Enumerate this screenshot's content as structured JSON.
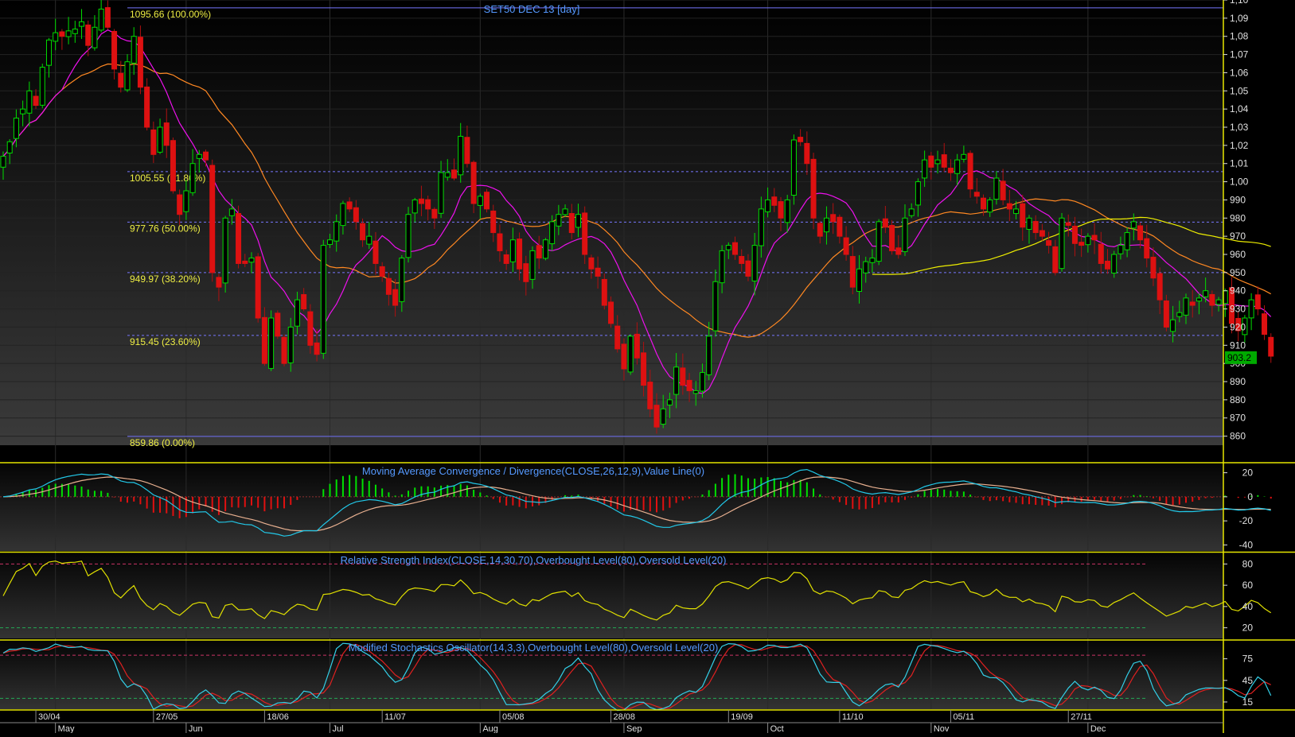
{
  "chart_data": [
    {
      "type": "candlestick",
      "title": "SET50 DEC 13   [day]",
      "ylim": [
        855,
        1100
      ],
      "y_ticks": [
        860,
        870,
        880,
        890,
        900,
        910,
        920,
        930,
        940,
        950,
        960,
        970,
        980,
        990,
        1000,
        1010,
        1020,
        1030,
        1040,
        1050,
        1060,
        1070,
        1080,
        1090,
        1100
      ],
      "y_tick_labels": [
        "860",
        "870",
        "880",
        "890",
        "900",
        "910",
        "920",
        "930",
        "940",
        "950",
        "960",
        "970",
        "980",
        "990",
        "1,00",
        "1,01",
        "1,02",
        "1,03",
        "1,04",
        "1,05",
        "1,06",
        "1,07",
        "1,08",
        "1,09",
        "1,10"
      ],
      "last_price_label": "903.2",
      "last_price": 903.2,
      "fibonacci": [
        {
          "value": 1095.66,
          "label": "1095.66 (100.00%)"
        },
        {
          "value": 1005.55,
          "label": "1005.55 (61.80%)"
        },
        {
          "value": 977.76,
          "label": "977.76 (50.00%)"
        },
        {
          "value": 949.97,
          "label": "949.97 (38.20%)"
        },
        {
          "value": 915.45,
          "label": "915.45 (23.60%)"
        },
        {
          "value": 859.86,
          "label": "859.86 (0.00%)"
        }
      ],
      "closes": [
        1014,
        1022,
        1035,
        1040,
        1050,
        1042,
        1063,
        1078,
        1082,
        1080,
        1083,
        1084,
        1088,
        1075,
        1085,
        1095,
        1085,
        1062,
        1052,
        1066,
        1080,
        1052,
        1030,
        1015,
        1030,
        1020,
        995,
        982,
        995,
        1010,
        1015,
        1012,
        950,
        942,
        980,
        985,
        955,
        955,
        958,
        925,
        900,
        925,
        915,
        900,
        920,
        935,
        930,
        910,
        905,
        965,
        968,
        978,
        988,
        985,
        978,
        968,
        970,
        955,
        948,
        938,
        932,
        958,
        982,
        990,
        988,
        985,
        980,
        1005,
        1005,
        1002,
        1025,
        1010,
        988,
        992,
        985,
        972,
        962,
        955,
        968,
        952,
        945,
        962,
        958,
        968,
        978,
        982,
        985,
        972,
        982,
        960,
        952,
        948,
        932,
        922,
        908,
        897,
        915,
        903,
        888,
        875,
        865,
        875,
        880,
        898,
        888,
        885,
        885,
        895,
        915,
        945,
        962,
        965,
        960,
        955,
        948,
        965,
        985,
        990,
        987,
        980,
        990,
        1023,
        1022,
        1010,
        980,
        970,
        980,
        978,
        970,
        960,
        942,
        952,
        956,
        958,
        978,
        975,
        962,
        960,
        980,
        985,
        1000,
        1012,
        1008,
        1012,
        1008,
        1005,
        1012,
        1015,
        996,
        992,
        985,
        990,
        1002,
        990,
        985,
        985,
        975,
        980,
        972,
        970,
        965,
        950,
        980,
        976,
        966,
        965,
        970,
        968,
        955,
        952,
        960,
        965,
        972,
        978,
        968,
        958,
        947,
        935,
        920,
        924,
        928,
        936,
        932,
        936,
        940,
        932,
        935,
        940,
        922,
        918,
        925,
        935,
        930,
        916,
        904
      ]
    },
    {
      "type": "line",
      "title": "Moving Average Convergence / Divergence(CLOSE,26,12,9),Value Line(0)",
      "ylim": [
        -45,
        27
      ],
      "y_ticks": [
        -40,
        -20,
        0,
        20
      ],
      "y_tick_labels": [
        "-40",
        "-20",
        "0",
        "20"
      ]
    },
    {
      "type": "line",
      "title": "Relative Strength Index(CLOSE,14,30,70),Overbought Level(80),Oversold Level(20)",
      "ylim": [
        10,
        90
      ],
      "y_ticks": [
        20,
        40,
        60,
        80
      ],
      "y_tick_labels": [
        "20",
        "40",
        "60",
        "80"
      ],
      "overbought": 80,
      "oversold": 20
    },
    {
      "type": "line",
      "title": "Modified Stochastics Oscillator(14,3,3),Overbought Level(80),Oversold Level(20)",
      "ylim": [
        5,
        100
      ],
      "y_ticks": [
        15,
        45,
        75
      ],
      "y_tick_labels": [
        "15",
        "45",
        "75"
      ],
      "overbought": 80,
      "oversold": 20
    }
  ],
  "x_axis": {
    "dates": [
      "30/04",
      "27/05",
      "18/06",
      "11/07",
      "05/08",
      "28/08",
      "19/09",
      "11/10",
      "05/11",
      "27/11"
    ],
    "months": [
      "May",
      "Jun",
      "Jul",
      "Aug",
      "Sep",
      "Oct",
      "Nov",
      "Dec"
    ]
  },
  "colors": {
    "up": "#00dd00",
    "down": "#dd1111",
    "ma_fast": "#ee11ee",
    "ma_slow": "#ff8822",
    "ma_long": "#eeee00",
    "fib": "#7777ff",
    "fib_text": "#eeee44",
    "title_text": "#5599ff",
    "axis_text": "#e0e0e0",
    "panel_border": "#e6e600",
    "macd_line": "#22c8e8",
    "signal_line": "#e8b090",
    "rsi_line": "#e0e000",
    "stoch_k": "#33d0e8",
    "stoch_d": "#e02020"
  }
}
